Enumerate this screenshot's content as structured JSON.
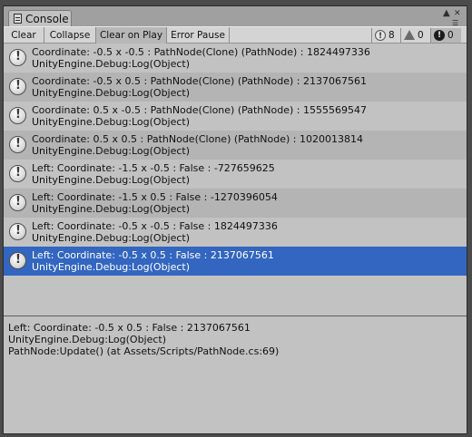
{
  "window": {
    "tab_label": "Console"
  },
  "toolbar": {
    "buttons": [
      {
        "label": "Clear",
        "active": false
      },
      {
        "label": "Collapse",
        "active": false
      },
      {
        "label": "Clear on Play",
        "active": true
      },
      {
        "label": "Error Pause",
        "active": false
      }
    ],
    "counters": {
      "info": "8",
      "warnings": "0",
      "errors": "0"
    }
  },
  "entries": [
    {
      "line1": "Coordinate: -0.5 x -0.5 : PathNode(Clone) (PathNode) : 1824497336",
      "line2": "UnityEngine.Debug:Log(Object)"
    },
    {
      "line1": "Coordinate: -0.5 x 0.5 : PathNode(Clone) (PathNode) : 2137067561",
      "line2": "UnityEngine.Debug:Log(Object)"
    },
    {
      "line1": "Coordinate: 0.5 x -0.5 : PathNode(Clone) (PathNode) : 1555569547",
      "line2": "UnityEngine.Debug:Log(Object)"
    },
    {
      "line1": "Coordinate: 0.5 x 0.5 : PathNode(Clone) (PathNode) : 1020013814",
      "line2": "UnityEngine.Debug:Log(Object)"
    },
    {
      "line1": "Left: Coordinate: -1.5 x -0.5 : False : -727659625",
      "line2": "UnityEngine.Debug:Log(Object)"
    },
    {
      "line1": "Left: Coordinate: -1.5 x 0.5 : False : -1270396054",
      "line2": "UnityEngine.Debug:Log(Object)"
    },
    {
      "line1": "Left: Coordinate: -0.5 x -0.5 : False : 1824497336",
      "line2": "UnityEngine.Debug:Log(Object)"
    },
    {
      "line1": "Left: Coordinate: -0.5 x 0.5 : False : 2137067561",
      "line2": "UnityEngine.Debug:Log(Object)",
      "selected": true
    }
  ],
  "detail": {
    "lines": [
      "Left: Coordinate: -0.5 x 0.5 : False : 2137067561",
      "UnityEngine.Debug:Log(Object)",
      "PathNode:Update() (at Assets/Scripts/PathNode.cs:69)"
    ]
  },
  "colors": {
    "selection": "#3366c0",
    "panel": "#c2c2c2",
    "row_alt": "#b4b4b4"
  },
  "icons": {
    "tab": "console-icon",
    "entry": "info-message-icon",
    "counter_info": "info-icon",
    "counter_warning": "warning-icon",
    "counter_error": "error-icon"
  }
}
